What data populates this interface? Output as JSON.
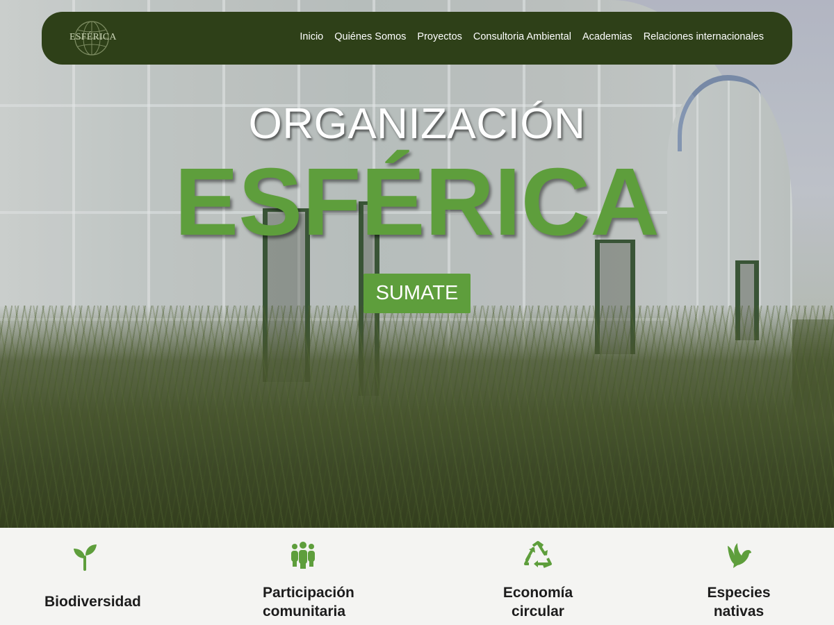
{
  "brand": {
    "logo_text": "ESFÉRICA"
  },
  "nav": {
    "items": [
      {
        "label": "Inicio"
      },
      {
        "label": "Quiénes Somos"
      },
      {
        "label": "Proyectos"
      },
      {
        "label": "Consultoria Ambiental"
      },
      {
        "label": "Academias"
      },
      {
        "label": "Relaciones internacionales"
      }
    ]
  },
  "hero": {
    "title_line1": "ORGANIZACIÓN",
    "title_line2": "ESFÉRICA",
    "cta_label": "SUMATE"
  },
  "features": [
    {
      "label": "Biodiversidad",
      "icon": "sprout-icon"
    },
    {
      "label": "Participación comunitaria",
      "icon": "people-icon"
    },
    {
      "label": "Economía circular",
      "icon": "recycle-icon"
    },
    {
      "label": "Especies nativas",
      "icon": "dove-icon"
    }
  ],
  "colors": {
    "nav_bg": "#2e4018",
    "accent_green": "#5e9e3c",
    "features_bg": "#f4f4f2"
  }
}
